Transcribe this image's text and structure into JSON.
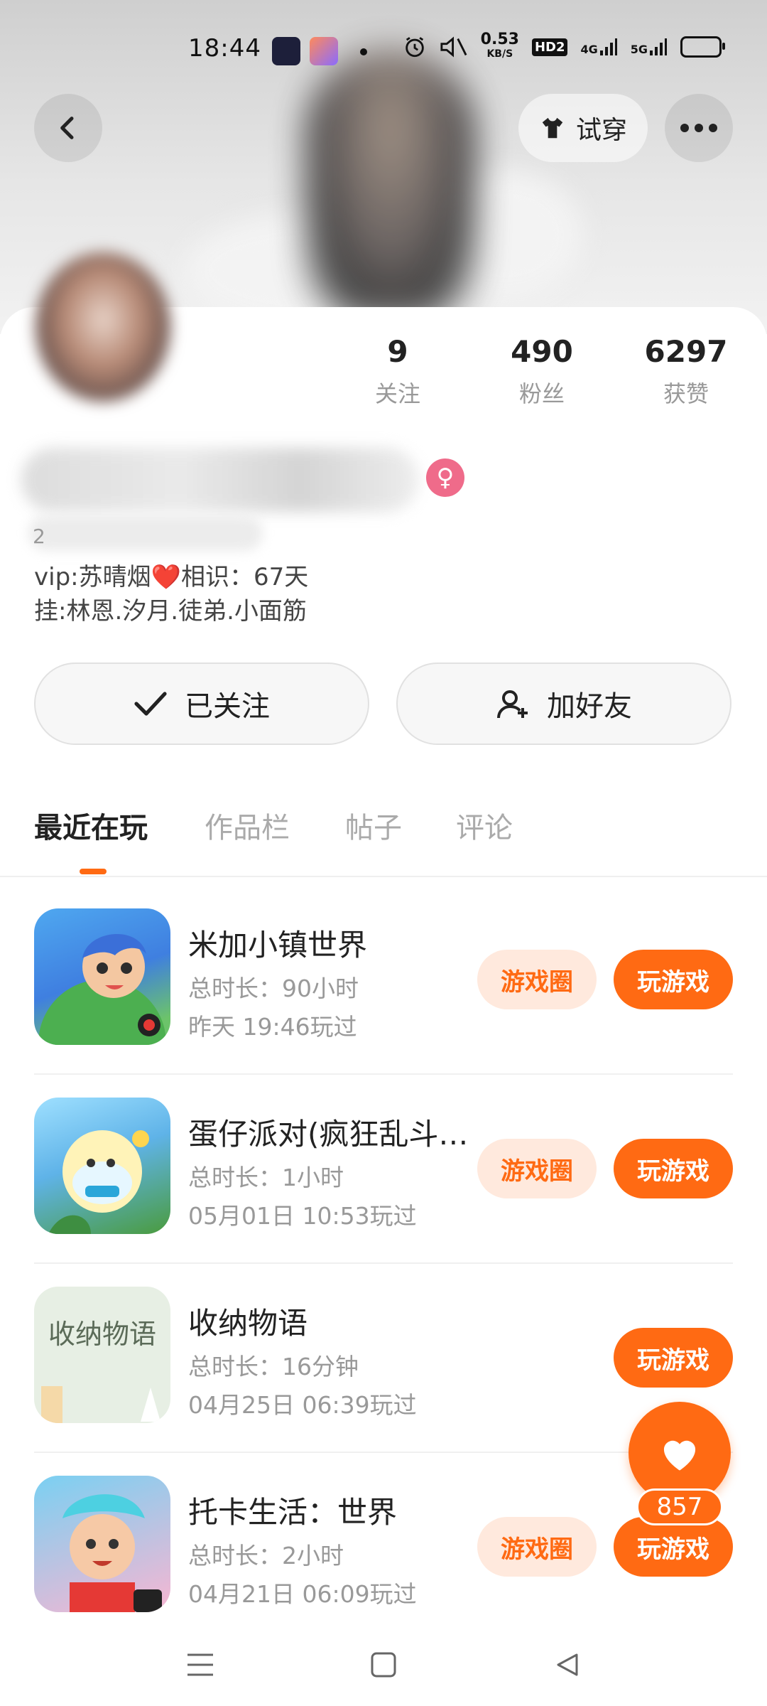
{
  "status_bar": {
    "time": "18:44",
    "network_speed": "0.53",
    "network_unit": "KB/S",
    "hd_badge": "HD2",
    "signal1": "4G",
    "signal2": "5G"
  },
  "header": {
    "back_icon": "back-arrow-icon",
    "tryon_label": "试穿",
    "more_icon": "more-horizontal-icon"
  },
  "profile": {
    "stats": [
      {
        "value": "9",
        "label": "关注"
      },
      {
        "value": "490",
        "label": "粉丝"
      },
      {
        "value": "6297",
        "label": "获赞"
      }
    ],
    "gender_symbol": "♀",
    "sub_line_prefix": "2",
    "bio_line1": "vip:苏晴烟❤️相识：67天",
    "bio_line2": "挂:林恩.汐月.徒弟.小面筋"
  },
  "actions": {
    "followed_label": "已关注",
    "add_friend_label": "加好友"
  },
  "tabs": [
    {
      "label": "最近在玩",
      "active": true
    },
    {
      "label": "作品栏",
      "active": false
    },
    {
      "label": "帖子",
      "active": false
    },
    {
      "label": "评论",
      "active": false
    }
  ],
  "games": [
    {
      "title": "米加小镇世界",
      "duration": "总时长：90小时",
      "last_played": "昨天 19:46玩过",
      "circle_label": "游戏圈",
      "play_label": "玩游戏",
      "has_circle": true
    },
    {
      "title": "蛋仔派对(疯狂乱斗…",
      "duration": "总时长：1小时",
      "last_played": "05月01日 10:53玩过",
      "circle_label": "游戏圈",
      "play_label": "玩游戏",
      "has_circle": true
    },
    {
      "title": "收纳物语",
      "duration": "总时长：16分钟",
      "last_played": "04月25日 06:39玩过",
      "circle_label": "",
      "play_label": "玩游戏",
      "has_circle": false,
      "icon_text": "收纳物语"
    },
    {
      "title": "托卡生活：世界",
      "duration": "总时长：2小时",
      "last_played": "04月21日 06:09玩过",
      "circle_label": "游戏圈",
      "play_label": "玩游戏",
      "has_circle": true
    }
  ],
  "fab": {
    "icon": "heart-icon",
    "count": "857"
  },
  "colors": {
    "accent": "#ff6a13",
    "accent_light": "#ffe9dd",
    "gender_badge": "#ef6b8a"
  }
}
